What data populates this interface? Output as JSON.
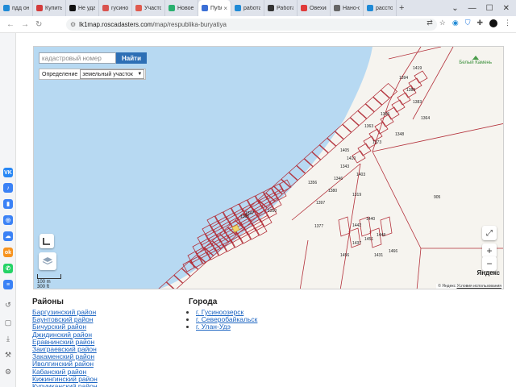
{
  "browser": {
    "tabs": [
      {
        "label": "пдд онл",
        "color": "#1f8ad6"
      },
      {
        "label": "Купить",
        "color": "#d43c3c"
      },
      {
        "label": "Не удал",
        "color": "#111111"
      },
      {
        "label": "гусиноо",
        "color": "#d9534f"
      },
      {
        "label": "Участок",
        "color": "#e05a4e"
      },
      {
        "label": "Новое",
        "color": "#2ab06f"
      },
      {
        "label": "Публич",
        "color": "#3b6fd6",
        "active": true
      },
      {
        "label": "работа",
        "color": "#1f8ad6"
      },
      {
        "label": "Работа",
        "color": "#333333"
      },
      {
        "label": "Овехим",
        "color": "#e03a3a"
      },
      {
        "label": "Нано-ф",
        "color": "#666666"
      },
      {
        "label": "расстоя",
        "color": "#1f8ad6"
      }
    ],
    "new_tab": "+",
    "url_domain": "lk1map.roscadasters.com",
    "url_path": "/map/respublika-buryatiya"
  },
  "map": {
    "search_placeholder": "кадастровый номер",
    "find_button": "Найти",
    "definition_label": "Определение",
    "definition_value": "земельный участок",
    "brand": "Белый Камень",
    "scale_m": "100 m",
    "scale_ft": "300 ft",
    "yandex": "Яндекс",
    "terms_prefix": "© Яндекс",
    "terms_link": "Условия использования",
    "parcel_labels": [
      "905",
      "1377",
      "1356",
      "1343",
      "1319",
      "1346",
      "1394",
      "1389",
      "1365",
      "1363",
      "1373",
      "1383",
      "1364",
      "1348",
      "1305",
      "1442",
      "1440",
      "1448",
      "1437",
      "1451",
      "1456",
      "1466",
      "1431",
      "1419",
      "1405",
      "1410",
      "1403",
      "1347",
      "1350",
      "1397",
      "1380"
    ],
    "colors": {
      "water": "#b7d9f2",
      "land": "#f6f4ef",
      "parcel": "#b3303a"
    }
  },
  "regions": {
    "title": "Районы",
    "items": [
      "Баргузинский район",
      "Баунтовский район",
      "Бичурский район",
      "Джидинский район",
      "Еравнинский район",
      "Заиграевский район",
      "Закаменский район",
      "Иволгинский район",
      "Кабанский район",
      "Кижингинский район",
      "Курумканский район"
    ]
  },
  "cities": {
    "title": "Города",
    "items": [
      "г. Гусиноозерск",
      "г. Северобайкальск",
      "г. Улан-Удэ"
    ]
  }
}
